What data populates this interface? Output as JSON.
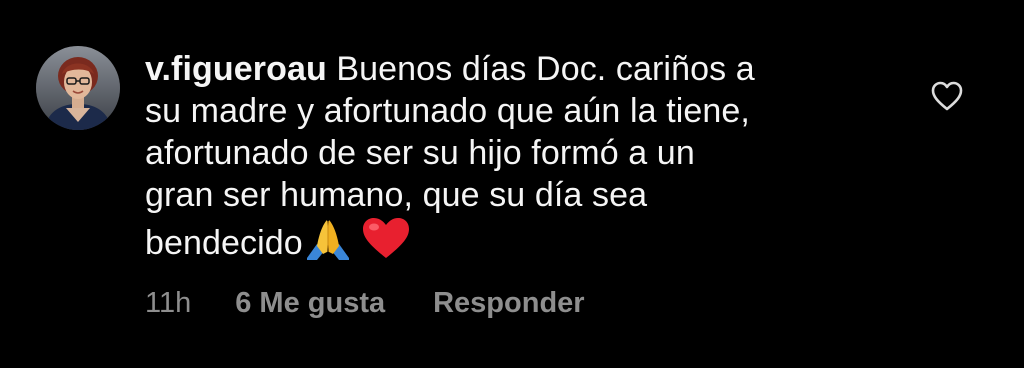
{
  "comment": {
    "username": "v.figueroau",
    "text_lines": [
      "Buenos días Doc. cariños a",
      "su madre y afortunado que aún la tiene,",
      "afortunado de ser su hijo formó a un",
      "gran ser humano, que su día sea",
      "bendecido"
    ],
    "emojis": [
      "folded-hands",
      "red-heart"
    ],
    "time": "11h",
    "likes": "6 Me gusta",
    "reply_label": "Responder"
  },
  "colors": {
    "background": "#000000",
    "text": "#f5f5f5",
    "meta": "#8e8e8e"
  },
  "icons": {
    "like": "heart-outline-icon"
  }
}
